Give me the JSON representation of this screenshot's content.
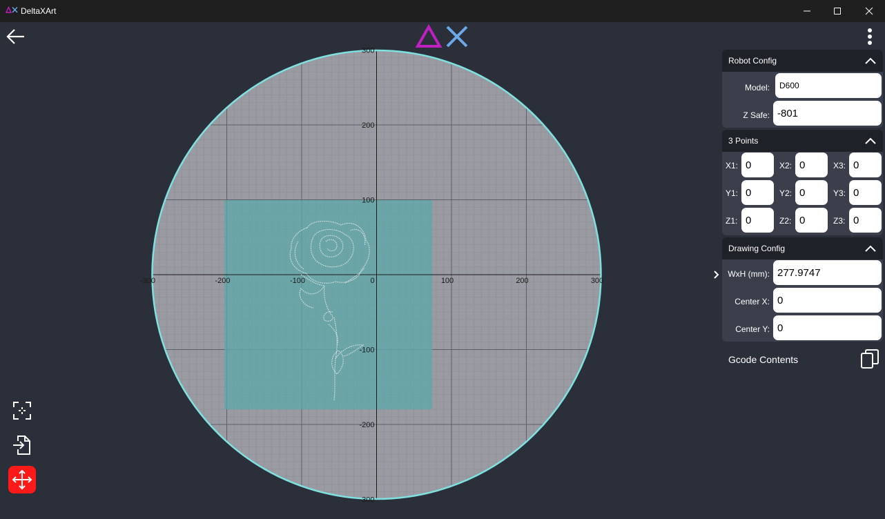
{
  "window": {
    "title": "DeltaXArt"
  },
  "icons": {
    "app_logo": "delta-x-logo-icon",
    "back": "arrow-left-icon",
    "more": "more-vertical-icon",
    "fit": "fit-screen-icon",
    "import": "file-import-icon",
    "move": "move-arrows-icon",
    "copy": "copy-icon",
    "expand": "chevron-right-icon",
    "collapse": "chevron-up-icon"
  },
  "colors": {
    "accent": "#ff1a1a",
    "circle": "#7fe0e0",
    "drawing_area": "#5fa8a8",
    "logo_triangle": "#c020c0",
    "logo_x": "#6aa8e8"
  },
  "canvas": {
    "x_ticks": [
      "-300",
      "-200",
      "-100",
      "0",
      "100",
      "200",
      "300"
    ],
    "y_ticks": [
      "300",
      "200",
      "100",
      "-100",
      "-200",
      "-300"
    ]
  },
  "robot_config": {
    "title": "Robot Config",
    "model_label": "Model:",
    "model_value": "D600",
    "zsafe_label": "Z Safe:",
    "zsafe_value": "-801"
  },
  "three_points": {
    "title": "3 Points",
    "rows": [
      [
        {
          "label": "X1:",
          "value": "0"
        },
        {
          "label": "X2:",
          "value": "0"
        },
        {
          "label": "X3:",
          "value": "0"
        }
      ],
      [
        {
          "label": "Y1:",
          "value": "0"
        },
        {
          "label": "Y2:",
          "value": "0"
        },
        {
          "label": "Y3:",
          "value": "0"
        }
      ],
      [
        {
          "label": "Z1:",
          "value": "0"
        },
        {
          "label": "Z2:",
          "value": "0"
        },
        {
          "label": "Z3:",
          "value": "0"
        }
      ]
    ]
  },
  "drawing_config": {
    "title": "Drawing Config",
    "wxh_label": "WxH (mm):",
    "wxh_value": "277.9747",
    "cx_label": "Center X:",
    "cx_value": "0",
    "cy_label": "Center Y:",
    "cy_value": "0"
  },
  "gcode": {
    "label": "Gcode Contents"
  }
}
